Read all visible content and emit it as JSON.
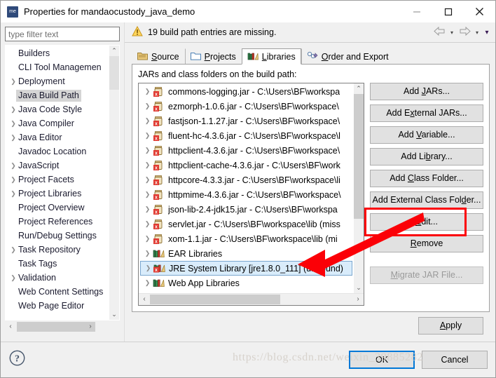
{
  "window": {
    "app_icon_label": "me",
    "title": "Properties for mandaocustody_java_demo",
    "minimize_label": "–",
    "maximize_label": "□",
    "close_label": "×"
  },
  "sidebar": {
    "filter_placeholder": "type filter text",
    "filter_value": "",
    "items": [
      {
        "label": "Builders",
        "expandable": false,
        "selected": false
      },
      {
        "label": "CLI Tool Managemen",
        "expandable": false,
        "selected": false
      },
      {
        "label": "Deployment",
        "expandable": true,
        "selected": false
      },
      {
        "label": "Java Build Path",
        "expandable": false,
        "selected": true
      },
      {
        "label": "Java Code Style",
        "expandable": true,
        "selected": false
      },
      {
        "label": "Java Compiler",
        "expandable": true,
        "selected": false
      },
      {
        "label": "Java Editor",
        "expandable": true,
        "selected": false
      },
      {
        "label": "Javadoc Location",
        "expandable": false,
        "selected": false
      },
      {
        "label": "JavaScript",
        "expandable": true,
        "selected": false
      },
      {
        "label": "Project Facets",
        "expandable": true,
        "selected": false
      },
      {
        "label": "Project Libraries",
        "expandable": true,
        "selected": false
      },
      {
        "label": "Project Overview",
        "expandable": false,
        "selected": false
      },
      {
        "label": "Project References",
        "expandable": false,
        "selected": false
      },
      {
        "label": "Run/Debug Settings",
        "expandable": false,
        "selected": false
      },
      {
        "label": "Task Repository",
        "expandable": true,
        "selected": false
      },
      {
        "label": "Task Tags",
        "expandable": false,
        "selected": false
      },
      {
        "label": "Validation",
        "expandable": true,
        "selected": false
      },
      {
        "label": "Web Content Settings",
        "expandable": false,
        "selected": false
      },
      {
        "label": "Web Page Editor",
        "expandable": false,
        "selected": false
      }
    ],
    "scroll_up_glyph": "⌃",
    "scroll_down_glyph": "⌄",
    "scroll_left_glyph": "‹",
    "scroll_right_glyph": "›"
  },
  "message_bar": {
    "icon": "warning-icon",
    "text": "19 build path entries are missing.",
    "back_label": "⇦",
    "forward_label": "⇨",
    "caret": "▾"
  },
  "tabs": [
    {
      "label_pre": "",
      "accel": "S",
      "label_post": "ource",
      "icon": "source-folder-icon",
      "active": false
    },
    {
      "label_pre": "",
      "accel": "P",
      "label_post": "rojects",
      "icon": "projects-folder-icon",
      "active": false
    },
    {
      "label_pre": "",
      "accel": "L",
      "label_post": "ibraries",
      "icon": "libraries-books-icon",
      "active": true
    },
    {
      "label_pre": "",
      "accel": "O",
      "label_post": "rder and Export",
      "icon": "order-export-icon",
      "active": false
    }
  ],
  "main": {
    "list_label": "JARs and class folders on the build path:",
    "entries": [
      {
        "text": "commons-logging.jar - C:\\Users\\BF\\workspa",
        "icon": "jar-missing-icon",
        "selected": false
      },
      {
        "text": "ezmorph-1.0.6.jar - C:\\Users\\BF\\workspace\\",
        "icon": "jar-missing-icon",
        "selected": false
      },
      {
        "text": "fastjson-1.1.27.jar - C:\\Users\\BF\\workspace\\",
        "icon": "jar-missing-icon",
        "selected": false
      },
      {
        "text": "fluent-hc-4.3.6.jar - C:\\Users\\BF\\workspace\\l",
        "icon": "jar-missing-icon",
        "selected": false
      },
      {
        "text": "httpclient-4.3.6.jar - C:\\Users\\BF\\workspace\\",
        "icon": "jar-missing-icon",
        "selected": false
      },
      {
        "text": "httpclient-cache-4.3.6.jar - C:\\Users\\BF\\work",
        "icon": "jar-missing-icon",
        "selected": false
      },
      {
        "text": "httpcore-4.3.3.jar - C:\\Users\\BF\\workspace\\li",
        "icon": "jar-missing-icon",
        "selected": false
      },
      {
        "text": "httpmime-4.3.6.jar - C:\\Users\\BF\\workspace\\",
        "icon": "jar-missing-icon",
        "selected": false
      },
      {
        "text": "json-lib-2.4-jdk15.jar - C:\\Users\\BF\\workspa",
        "icon": "jar-missing-icon",
        "selected": false
      },
      {
        "text": "servlet.jar - C:\\Users\\BF\\workspace\\lib (miss",
        "icon": "jar-missing-icon",
        "selected": false
      },
      {
        "text": "xom-1.1.jar - C:\\Users\\BF\\workspace\\lib (mi",
        "icon": "jar-missing-icon",
        "selected": false
      },
      {
        "text": "EAR Libraries",
        "icon": "library-books-icon",
        "selected": false
      },
      {
        "text": "JRE System Library [jre1.8.0_111] (unbound)",
        "icon": "library-missing-icon",
        "selected": true
      },
      {
        "text": "Web App Libraries",
        "icon": "library-books-icon",
        "selected": false
      }
    ]
  },
  "buttons": {
    "add_jars": {
      "pre": "Add ",
      "accel": "J",
      "post": "ARs..."
    },
    "add_external_jars": {
      "pre": "Add E",
      "accel": "x",
      "post": "ternal JARs..."
    },
    "add_variable": {
      "pre": "Add ",
      "accel": "V",
      "post": "ariable..."
    },
    "add_library": {
      "pre": "Add Li",
      "accel": "b",
      "post": "rary..."
    },
    "add_class_folder": {
      "pre": "Add ",
      "accel": "C",
      "post": "lass Folder..."
    },
    "add_external_class_folder": {
      "pre": "Add External Class Fol",
      "accel": "d",
      "post": "er..."
    },
    "edit": {
      "pre": "",
      "accel": "E",
      "post": "dit..."
    },
    "remove": {
      "pre": "",
      "accel": "R",
      "post": "emove"
    },
    "migrate_jar_file": {
      "pre": "",
      "accel": "M",
      "post": "igrate JAR File...",
      "disabled": true
    },
    "apply": {
      "pre": "",
      "accel": "A",
      "post": "pply"
    },
    "ok": "OK",
    "cancel": "Cancel"
  },
  "footer": {
    "help_icon": "help-question-icon"
  },
  "annotation": {
    "highlight_color": "#fb0007",
    "target": "edit-button"
  },
  "watermark": {
    "text": "https://blog.csdn.net/weixin_39885282"
  }
}
